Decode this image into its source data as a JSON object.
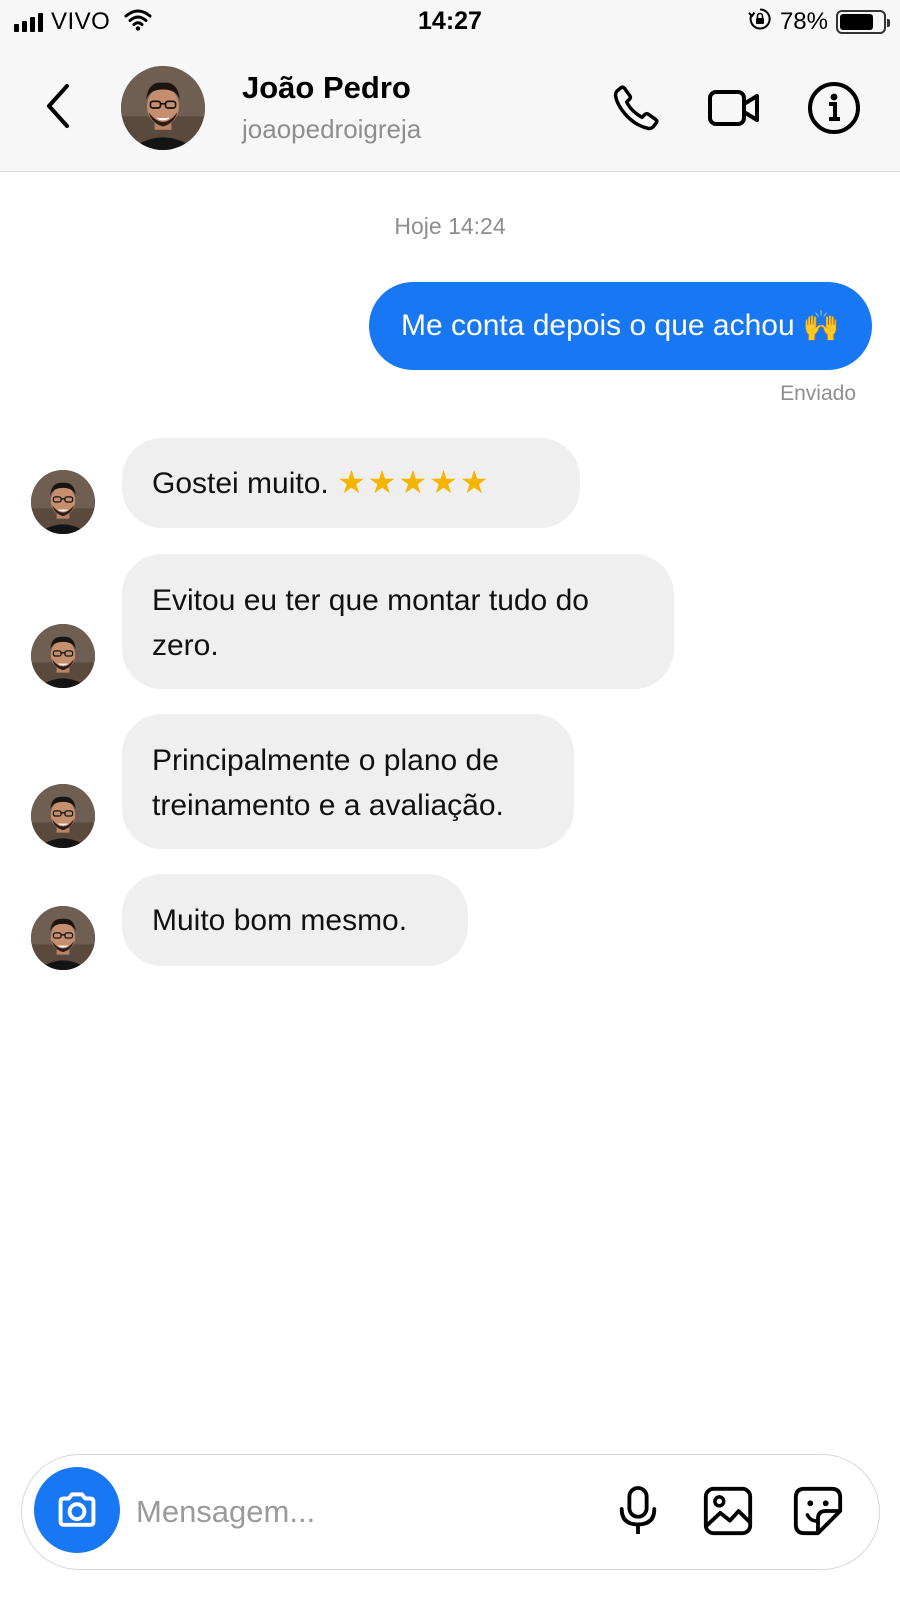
{
  "status_bar": {
    "carrier": "VIVO",
    "time": "14:27",
    "battery": "78%",
    "battery_level": 0.78,
    "icons": [
      "signal-icon",
      "wifi-icon",
      "orientation-lock-icon",
      "battery-icon"
    ]
  },
  "header": {
    "name": "João Pedro",
    "username": "joaopedroigreja",
    "icons": [
      "back-icon",
      "phone-icon",
      "video-icon",
      "info-icon"
    ]
  },
  "conversation": {
    "timestamp": "Hoje 14:24",
    "outgoing": {
      "text": "Me conta depois o que achou",
      "emoji": "🙌",
      "status": "Enviado"
    },
    "incoming": [
      {
        "text": "Gostei muito.",
        "stars": "★★★★★"
      },
      {
        "text": "Evitou eu ter que montar tudo do zero."
      },
      {
        "text": "Principalmente o plano de treinamento e a avaliação."
      },
      {
        "text": "Muito bom mesmo."
      }
    ]
  },
  "composer": {
    "placeholder": "Mensagem...",
    "value": "",
    "icons": [
      "camera-icon",
      "microphone-icon",
      "gallery-icon",
      "sticker-icon"
    ]
  },
  "colors": {
    "accent": "#1877f2",
    "incoming_bubble": "#efefef",
    "header_bg": "#f7f7f7",
    "muted_text": "#8e8e8e"
  }
}
